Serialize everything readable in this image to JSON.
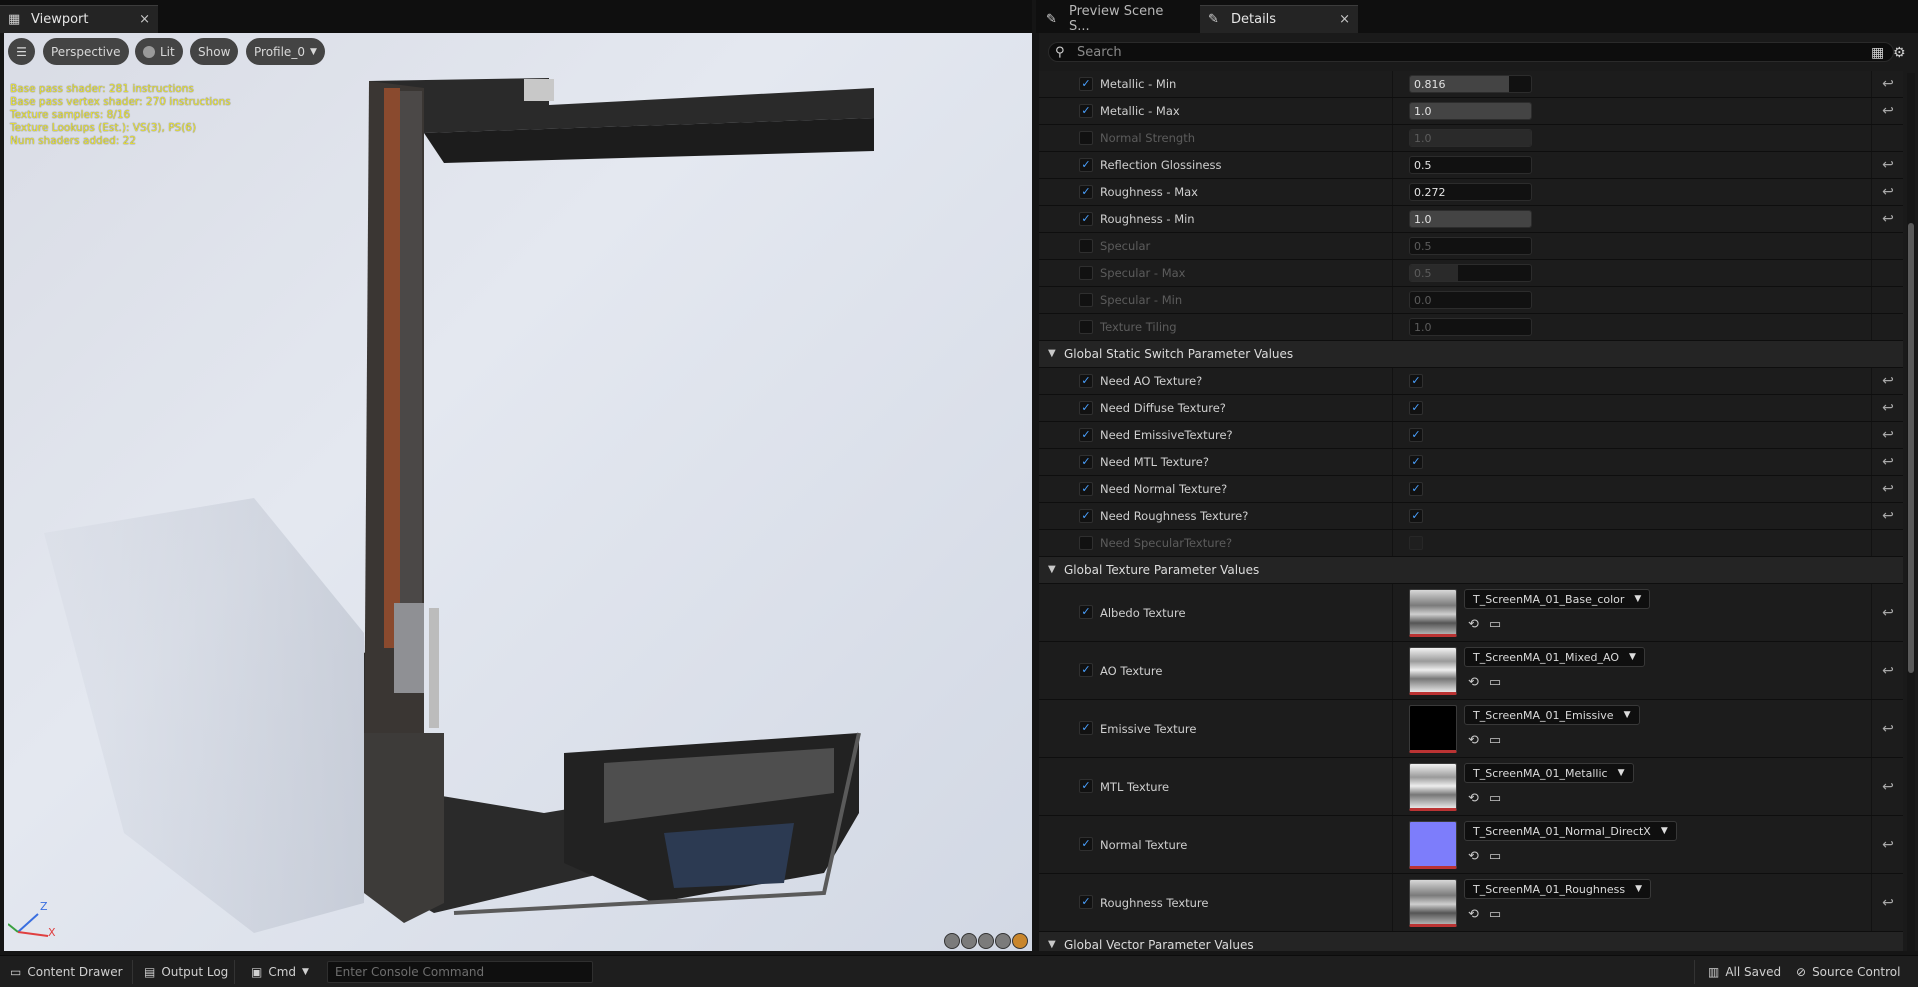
{
  "tabs": {
    "viewport": {
      "label": "Viewport",
      "close": "×"
    },
    "preview": {
      "label": "Preview Scene S..."
    },
    "details": {
      "label": "Details",
      "close": "×"
    }
  },
  "viewport": {
    "buttons": {
      "menu": "☰",
      "perspective": "Perspective",
      "lit": "Lit",
      "show": "Show",
      "profile": "Profile_0"
    },
    "stats": [
      "Base pass shader: 281 instructions",
      "Base pass vertex shader: 270 instructions",
      "Texture samplers: 8/16",
      "Texture Lookups (Est.): VS(3), PS(6)",
      "Num shaders added: 22"
    ],
    "axis": {
      "z": "Z",
      "x": "X"
    }
  },
  "details": {
    "search_placeholder": "Search",
    "scalar_rows": [
      {
        "label": "Metallic -  Min",
        "checked": true,
        "value": "0.816",
        "fill": 0.816,
        "enabled": true
      },
      {
        "label": "Metallic - Max",
        "checked": true,
        "value": "1.0",
        "fill": 1.0,
        "enabled": true
      },
      {
        "label": "Normal Strength",
        "checked": false,
        "value": "1.0",
        "fill": 1.0,
        "enabled": false
      },
      {
        "label": "Reflection Glossiness",
        "checked": true,
        "value": "0.5",
        "fill": 0.0,
        "enabled": true
      },
      {
        "label": "Roughness - Max",
        "checked": true,
        "value": "0.272",
        "fill": 0.0,
        "enabled": true
      },
      {
        "label": "Roughness - Min",
        "checked": true,
        "value": "1.0",
        "fill": 1.0,
        "enabled": true
      },
      {
        "label": "Specular",
        "checked": false,
        "value": "0.5",
        "fill": 0.0,
        "enabled": false
      },
      {
        "label": "Specular  - Max",
        "checked": false,
        "value": "0.5",
        "fill": 0.4,
        "enabled": false
      },
      {
        "label": "Specular - Min",
        "checked": false,
        "value": "0.0",
        "fill": 0.0,
        "enabled": false
      },
      {
        "label": "Texture Tiling",
        "checked": false,
        "value": "1.0",
        "fill": 0.0,
        "enabled": false
      }
    ],
    "switch_section": "Global Static Switch Parameter Values",
    "switch_rows": [
      {
        "label": "Need AO Texture?",
        "checked": true,
        "value": true,
        "enabled": true
      },
      {
        "label": "Need Diffuse Texture?",
        "checked": true,
        "value": true,
        "enabled": true
      },
      {
        "label": "Need EmissiveTexture?",
        "checked": true,
        "value": true,
        "enabled": true
      },
      {
        "label": "Need MTL Texture?",
        "checked": true,
        "value": true,
        "enabled": true
      },
      {
        "label": "Need Normal Texture?",
        "checked": true,
        "value": true,
        "enabled": true
      },
      {
        "label": "Need Roughness Texture?",
        "checked": true,
        "value": true,
        "enabled": true
      },
      {
        "label": "Need SpecularTexture?",
        "checked": false,
        "value": false,
        "enabled": false
      }
    ],
    "texture_section": "Global Texture Parameter Values",
    "texture_rows": [
      {
        "label": "Albedo Texture",
        "asset": "T_ScreenMA_01_Base_color",
        "thumb": "gray"
      },
      {
        "label": "AO Texture",
        "asset": "T_ScreenMA_01_Mixed_AO",
        "thumb": "light"
      },
      {
        "label": "Emissive Texture",
        "asset": "T_ScreenMA_01_Emissive",
        "thumb": "black"
      },
      {
        "label": "MTL Texture",
        "asset": "T_ScreenMA_01_Metallic",
        "thumb": "light"
      },
      {
        "label": "Normal Texture",
        "asset": "T_ScreenMA_01_Normal_DirectX",
        "thumb": "blue"
      },
      {
        "label": "Roughness Texture",
        "asset": "T_ScreenMA_01_Roughness",
        "thumb": "gray"
      }
    ],
    "vector_section": "Global Vector Parameter Values"
  },
  "statusbar": {
    "content_drawer": "Content Drawer",
    "output_log": "Output Log",
    "cmd": "Cmd",
    "console_placeholder": "Enter Console Command",
    "all_saved": "All Saved",
    "source_control": "Source Control"
  },
  "colors": {
    "accent": "#4aa0ff",
    "stats_text": "#e8e23a"
  }
}
